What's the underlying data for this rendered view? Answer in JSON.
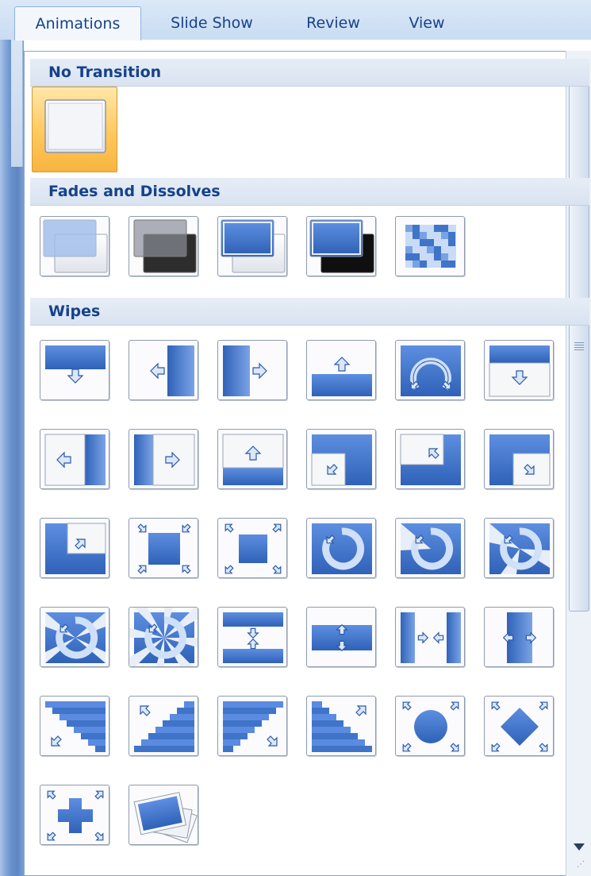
{
  "ribbon": {
    "tabs": [
      {
        "label": "Animations",
        "active": true
      },
      {
        "label": "Slide Show",
        "active": false
      },
      {
        "label": "Review",
        "active": false
      },
      {
        "label": "View",
        "active": false
      }
    ]
  },
  "gallery": {
    "sections": [
      {
        "title": "No Transition",
        "items": [
          "no-transition"
        ]
      },
      {
        "title": "Fades and Dissolves",
        "items": [
          "fade-smoothly",
          "fade-through-black",
          "cut",
          "cut-through-black",
          "dissolve"
        ]
      },
      {
        "title": "Wipes",
        "items": [
          "wipe-down",
          "wipe-left",
          "wipe-right",
          "wipe-up",
          "wedge",
          "uncover-down",
          "uncover-left",
          "uncover-right",
          "uncover-up",
          "uncover-left-down",
          "uncover-left-up",
          "uncover-right-down",
          "uncover-right-up",
          "box-in",
          "box-out",
          "wheel-1-spoke",
          "wheel-2-spokes",
          "wheel-3-spokes",
          "wheel-4-spokes",
          "wheel-8-spokes",
          "split-horizontal-in",
          "split-horizontal-out",
          "split-vertical-in",
          "split-vertical-out",
          "strips-left-down",
          "strips-left-up",
          "strips-right-down",
          "strips-right-up",
          "circle",
          "diamond",
          "plus",
          "random-transition"
        ]
      }
    ]
  },
  "colors": {
    "accent": "#15428b",
    "thumb_blue": "#3f74c9",
    "selected": "#ffc85c"
  },
  "scrollbar": {
    "up_icon": "scroll-up-arrow-icon",
    "down_icon": "scroll-down-arrow-icon"
  }
}
